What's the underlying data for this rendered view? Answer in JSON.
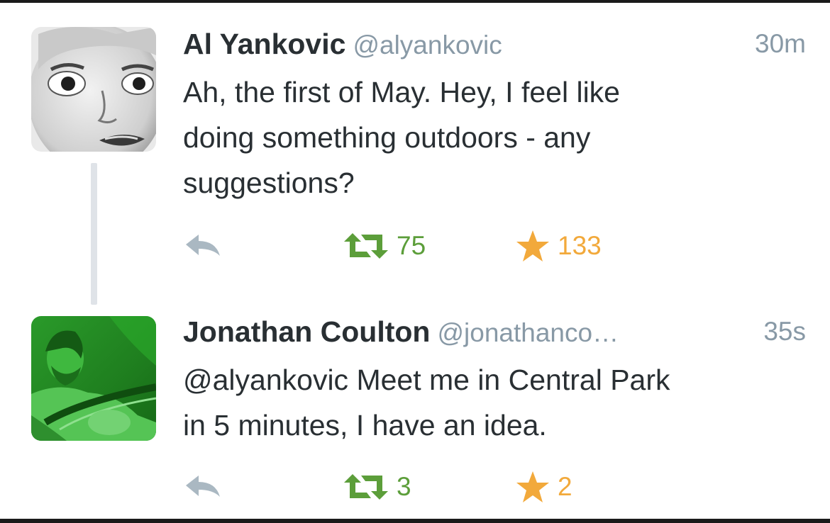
{
  "colors": {
    "name": "#292f33",
    "meta": "#8899a6",
    "retweet": "#5c9e3a",
    "favorite": "#f2a93b",
    "reply": "#aab8c2",
    "thread_line": "#dfe3e8"
  },
  "tweets": [
    {
      "name": "Al Yankovic",
      "handle": "@alyankovic",
      "time": "30m",
      "text": "Ah, the first of May.  Hey, I feel like\ndoing something outdoors - any\nsuggestions?",
      "retweets": "75",
      "favorites": "133",
      "icons": {
        "reply": "reply-icon",
        "retweet": "retweet-icon",
        "favorite": "star-icon"
      }
    },
    {
      "name": "Jonathan Coulton",
      "handle": "@jonathanco…",
      "time": "35s",
      "text": "@alyankovic Meet me in Central Park\nin 5 minutes, I have an idea.",
      "retweets": "3",
      "favorites": "2",
      "icons": {
        "reply": "reply-icon",
        "retweet": "retweet-icon",
        "favorite": "star-icon"
      }
    }
  ]
}
